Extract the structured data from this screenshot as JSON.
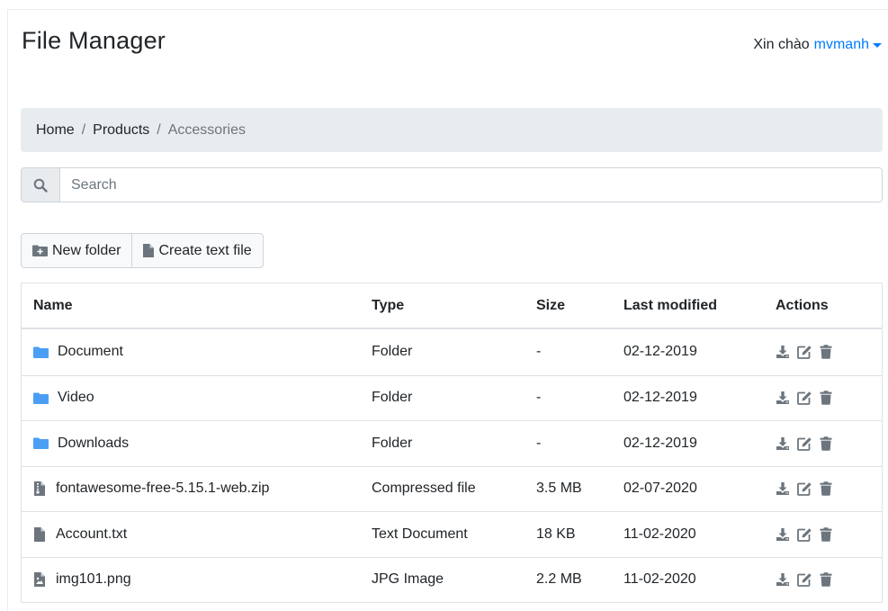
{
  "header": {
    "title": "File Manager",
    "greeting": "Xin chào",
    "username": "mvmanh"
  },
  "breadcrumb": {
    "items": [
      "Home",
      "Products"
    ],
    "separator": "/",
    "active": "Accessories"
  },
  "search": {
    "placeholder": "Search",
    "value": ""
  },
  "toolbar": {
    "new_folder_label": "New folder",
    "create_text_file_label": "Create text file"
  },
  "table": {
    "headers": {
      "name": "Name",
      "type": "Type",
      "size": "Size",
      "modified": "Last modified",
      "actions": "Actions"
    },
    "rows": [
      {
        "icon": "folder-icon",
        "name": "Document",
        "type": "Folder",
        "size": "-",
        "modified": "02-12-2019"
      },
      {
        "icon": "folder-icon",
        "name": "Video",
        "type": "Folder",
        "size": "-",
        "modified": "02-12-2019"
      },
      {
        "icon": "folder-icon",
        "name": "Downloads",
        "type": "Folder",
        "size": "-",
        "modified": "02-12-2019"
      },
      {
        "icon": "zip-file-icon",
        "name": "fontawesome-free-5.15.1-web.zip",
        "type": "Compressed file",
        "size": "3.5 MB",
        "modified": "02-07-2020"
      },
      {
        "icon": "text-file-icon",
        "name": "Account.txt",
        "type": "Text Document",
        "size": "18 KB",
        "modified": "11-02-2020"
      },
      {
        "icon": "image-file-icon",
        "name": "img101.png",
        "type": "JPG Image",
        "size": "2.2 MB",
        "modified": "11-02-2020"
      }
    ],
    "action_icons": [
      "download-icon",
      "edit-icon",
      "trash-icon"
    ]
  },
  "colors": {
    "link": "#007bff",
    "folder": "#4a9ff5",
    "file": "#6c757d",
    "breadcrumb_bg": "#e9ecef",
    "border": "#dee2e6"
  }
}
